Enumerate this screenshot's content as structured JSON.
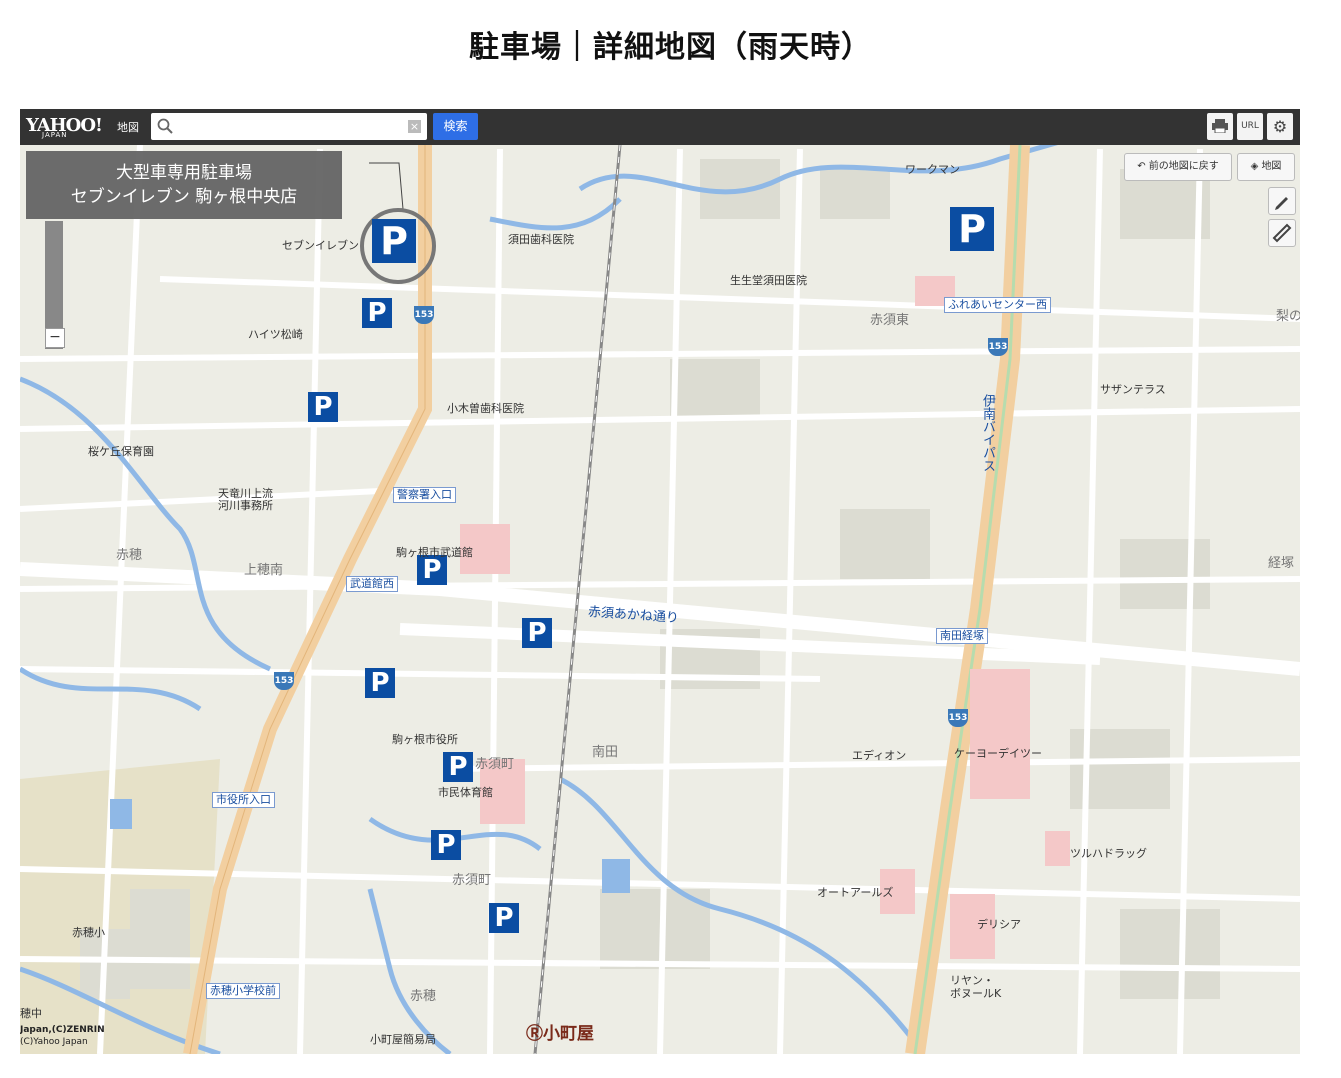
{
  "page": {
    "title": "駐車場｜詳細地図（雨天時）"
  },
  "toolbar": {
    "logo": "YAHOO!",
    "logo_sub": "JAPAN",
    "map_label": "地図",
    "search_placeholder": "",
    "clear": "×",
    "search_button": "検索",
    "print_icon": "print-icon",
    "url_button": "URL",
    "settings_icon": "gear-icon"
  },
  "controls": {
    "back_button": "前の地図に戻す",
    "layer_button": "地図",
    "zoom_out": "−"
  },
  "overlay": {
    "line1": "大型車専用駐車場",
    "line2": "セブンイレブン 駒ヶ根中央店"
  },
  "labels": {
    "seven": "セブンイレブン",
    "suda_dental": "須田歯科医院",
    "workman": "ワークマン",
    "seiseido": "生生堂須田医院",
    "haitsu": "ハイツ松崎",
    "akasuhigashi": "赤須東",
    "fureai": "ふれあいセンター西",
    "nashi": "梨の",
    "ogiso": "小木曽歯科医院",
    "sakuragaoka": "桜ケ丘保育園",
    "tenryu1": "天竜川上流",
    "tenryu2": "河川事務所",
    "keisatsu": "警察署入口",
    "sazan": "サザンテラス",
    "ibypass": "伊南バイパス",
    "akaho": "赤穂",
    "kamihominami": "上穂南",
    "budokan": "駒ヶ根市武道館",
    "budokannishi": "武道館西",
    "akane": "赤須あかね通り",
    "kyozuka": "経塚",
    "minamidakyozuka": "南田経塚",
    "shiyakusho": "駒ヶ根市役所",
    "akasucho": "赤須町",
    "minamida": "南田",
    "edion": "エディオン",
    "keiyo": "ケーヨーデイツー",
    "taiikukan": "市民体育館",
    "shiyakushoiriguchi": "市役所入口",
    "tsuruha": "ツルハドラッグ",
    "akasucho2": "赤須町",
    "autoarles": "オートアールズ",
    "delicia": "デリシア",
    "akahosho": "赤穂小",
    "akahoshoiriguchi": "赤穂小学校前",
    "akaho2": "赤穂",
    "ricyan1": "リヤン・",
    "ricyan2": "ボヌールK",
    "komachiya": "小町屋",
    "komachiyapost": "小町屋簡易局",
    "honchu": "穂中"
  },
  "route": "153",
  "parking_letter": "P",
  "copyright": {
    "line1": "Japan,(C)ZENRIN",
    "line2": "(C)Yahoo Japan"
  },
  "colors": {
    "map_bg": "#edede5",
    "road": "#ffffff",
    "highway": "#f2cfa0",
    "river": "#8fb8e6",
    "parking": "#0b4da2",
    "toolbar": "#333333",
    "facility": "#f4c8c8"
  }
}
